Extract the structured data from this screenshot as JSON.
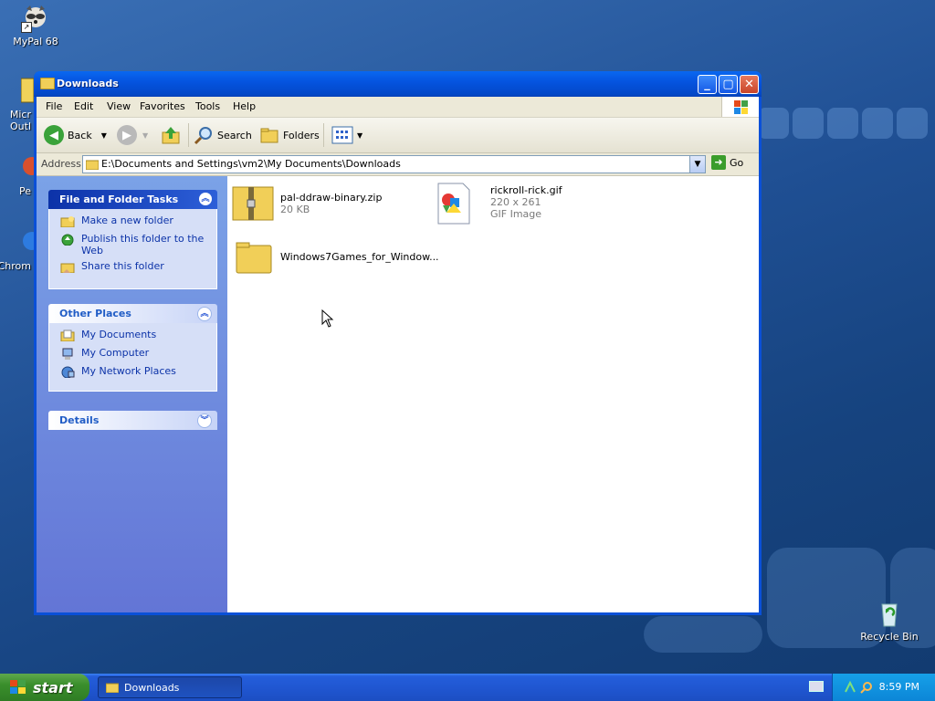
{
  "desktop": {
    "icons": [
      {
        "label": "MyPal 68"
      },
      {
        "label": "Micr\nOutl"
      },
      {
        "label": "Pe"
      },
      {
        "label": "Chrom"
      },
      {
        "label": "Recycle Bin"
      }
    ]
  },
  "window": {
    "title": "Downloads",
    "menu": [
      "File",
      "Edit",
      "View",
      "Favorites",
      "Tools",
      "Help"
    ],
    "toolbar": {
      "back": "Back",
      "search": "Search",
      "folders": "Folders"
    },
    "address": {
      "label": "Address",
      "value": "E:\\Documents and Settings\\vm2\\My Documents\\Downloads",
      "go": "Go"
    },
    "task_pane": {
      "file_tasks": {
        "title": "File and Folder Tasks",
        "items": [
          "Make a new folder",
          "Publish this folder to the Web",
          "Share this folder"
        ]
      },
      "other_places": {
        "title": "Other Places",
        "items": [
          "My Documents",
          "My Computer",
          "My Network Places"
        ]
      },
      "details": {
        "title": "Details"
      }
    },
    "files": [
      {
        "name": "pal-ddraw-binary.zip",
        "meta1": "20 KB",
        "meta2": ""
      },
      {
        "name": "rickroll-rick.gif",
        "meta1": "220 x 261",
        "meta2": "GIF Image"
      },
      {
        "name": "Windows7Games_for_Window...",
        "meta1": "",
        "meta2": ""
      }
    ]
  },
  "taskbar": {
    "start": "start",
    "task": "Downloads",
    "clock": "8:59 PM"
  }
}
